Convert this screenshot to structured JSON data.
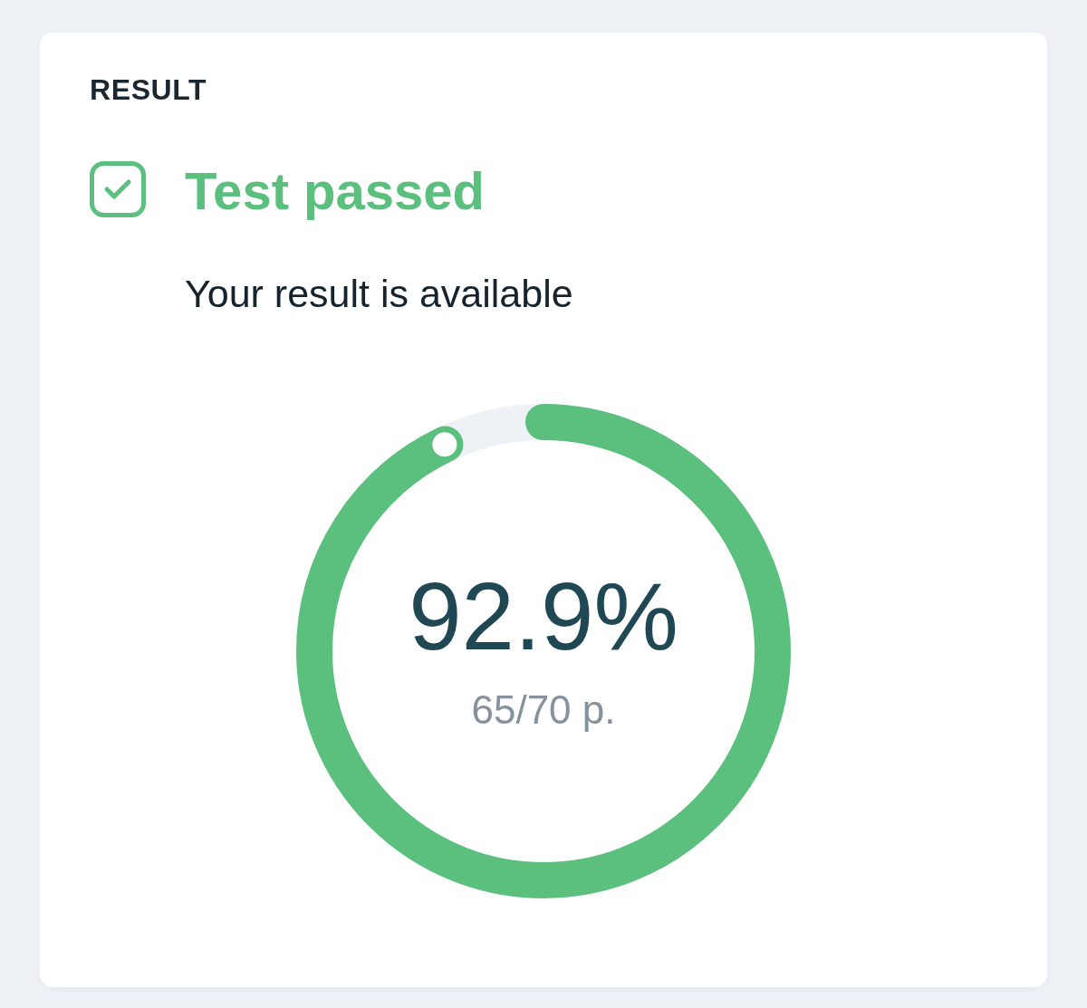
{
  "card": {
    "heading": "RESULT",
    "status": {
      "kind": "passed",
      "title": "Test passed",
      "subtitle": "Your result is available"
    },
    "score": {
      "level": 0.929,
      "percent": "92.9%",
      "points": "65/70 p."
    }
  }
}
